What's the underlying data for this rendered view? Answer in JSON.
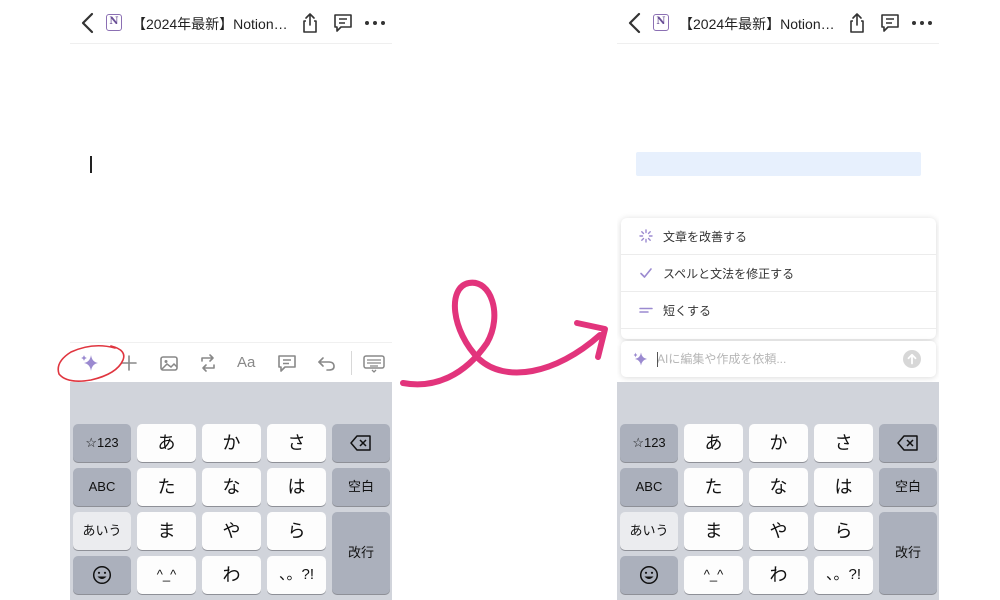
{
  "header": {
    "title": "【2024年最新】NotionAI...",
    "logo_letter": "N"
  },
  "toolbar": {
    "icons": [
      "ai-sparkle-icon",
      "add-block-icon",
      "image-icon",
      "turn-into-icon",
      "text-style-icon",
      "comment-icon",
      "undo-icon",
      "keyboard-dismiss-icon"
    ],
    "text_style_label": "Aa"
  },
  "keyboard": {
    "mode_numbers": "☆123",
    "mode_abc": "ABC",
    "mode_kana": "あいう",
    "row1": [
      "あ",
      "か",
      "さ"
    ],
    "row2": [
      "た",
      "な",
      "は"
    ],
    "row3": [
      "ま",
      "や",
      "ら"
    ],
    "row4_mid": "^_^",
    "row4_wa": "わ",
    "row4_punct": "、。?!",
    "space": "空白",
    "return": "改行"
  },
  "ai_menu": {
    "items": [
      {
        "label": "文章を改善する",
        "icon": "improve-writing-icon"
      },
      {
        "label": "スペルと文法を修正する",
        "icon": "checkmark-icon"
      },
      {
        "label": "短くする",
        "icon": "make-shorter-icon"
      }
    ],
    "input_placeholder": "AIに編集や作成を依頼..."
  },
  "colors": {
    "notion_purple": "#8b6fb3",
    "ai_accent": "#9b8ad0",
    "highlight": "#e7f0fd",
    "keyboard_bg": "#d1d4db",
    "annotation_pink": "#e2347c",
    "circle_red": "#e0353f"
  }
}
